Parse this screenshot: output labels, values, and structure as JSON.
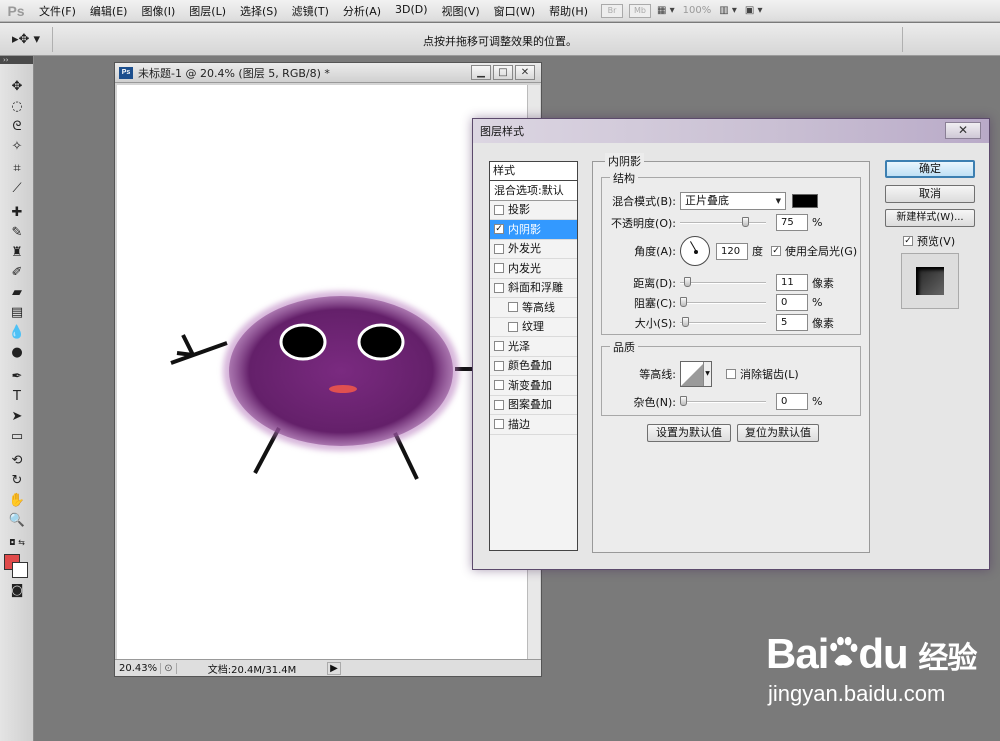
{
  "app": {
    "logo": "Ps"
  },
  "menu": [
    "文件(F)",
    "编辑(E)",
    "图像(I)",
    "图层(L)",
    "选择(S)",
    "滤镜(T)",
    "分析(A)",
    "3D(D)",
    "视图(V)",
    "窗口(W)",
    "帮助(H)"
  ],
  "toolbar_extras": {
    "br": "Br",
    "mb": "Mb",
    "zoom": "100%"
  },
  "options_bar": {
    "hint": "点按并拖移可调整效果的位置。"
  },
  "colors": {
    "foreground": "#e04a4a",
    "background": "#ffffff",
    "accent": "#3399ff",
    "character_body": "#6a1f6e"
  },
  "document": {
    "title": "未标题-1 @ 20.4% (图层 5, RGB/8) *",
    "zoom": "20.43%",
    "doc_info": "文档:20.4M/31.4M"
  },
  "dialog": {
    "title": "图层样式",
    "styles_header": "样式",
    "styles": [
      {
        "label": "混合选项:默认",
        "checkbox": false,
        "checked": false,
        "selected": false,
        "sub": false
      },
      {
        "label": "投影",
        "checkbox": true,
        "checked": false,
        "selected": false,
        "sub": false
      },
      {
        "label": "内阴影",
        "checkbox": true,
        "checked": true,
        "selected": true,
        "sub": false
      },
      {
        "label": "外发光",
        "checkbox": true,
        "checked": false,
        "selected": false,
        "sub": false
      },
      {
        "label": "内发光",
        "checkbox": true,
        "checked": false,
        "selected": false,
        "sub": false
      },
      {
        "label": "斜面和浮雕",
        "checkbox": true,
        "checked": false,
        "selected": false,
        "sub": false
      },
      {
        "label": "等高线",
        "checkbox": true,
        "checked": false,
        "selected": false,
        "sub": true
      },
      {
        "label": "纹理",
        "checkbox": true,
        "checked": false,
        "selected": false,
        "sub": true
      },
      {
        "label": "光泽",
        "checkbox": true,
        "checked": false,
        "selected": false,
        "sub": false
      },
      {
        "label": "颜色叠加",
        "checkbox": true,
        "checked": false,
        "selected": false,
        "sub": false
      },
      {
        "label": "渐变叠加",
        "checkbox": true,
        "checked": false,
        "selected": false,
        "sub": false
      },
      {
        "label": "图案叠加",
        "checkbox": true,
        "checked": false,
        "selected": false,
        "sub": false
      },
      {
        "label": "描边",
        "checkbox": true,
        "checked": false,
        "selected": false,
        "sub": false
      }
    ],
    "inner_shadow": {
      "section_title": "内阴影",
      "structure_title": "结构",
      "blend_mode_label": "混合模式(B):",
      "blend_mode_value": "正片叠底",
      "shadow_color": "#000000",
      "opacity_label": "不透明度(O):",
      "opacity_value": "75",
      "opacity_unit": "%",
      "angle_label": "角度(A):",
      "angle_value": "120",
      "angle_unit": "度",
      "global_light_label": "使用全局光(G)",
      "global_light_checked": true,
      "distance_label": "距离(D):",
      "distance_value": "11",
      "distance_unit": "像素",
      "choke_label": "阻塞(C):",
      "choke_value": "0",
      "choke_unit": "%",
      "size_label": "大小(S):",
      "size_value": "5",
      "size_unit": "像素",
      "quality_title": "品质",
      "contour_label": "等高线:",
      "anti_alias_label": "消除锯齿(L)",
      "anti_alias_checked": false,
      "noise_label": "杂色(N):",
      "noise_value": "0",
      "noise_unit": "%",
      "make_default": "设置为默认值",
      "reset_default": "复位为默认值"
    },
    "buttons": {
      "ok": "确定",
      "cancel": "取消",
      "new_style": "新建样式(W)...",
      "preview": "预览(V)",
      "preview_checked": true
    },
    "close_glyph": "✕"
  },
  "watermark": {
    "brand_a": "Bai",
    "brand_b": "du",
    "brand_cn": "经验",
    "url": "jingyan.baidu.com"
  }
}
